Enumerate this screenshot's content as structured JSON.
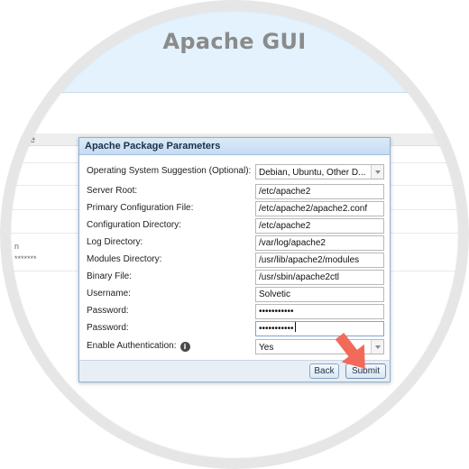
{
  "app": {
    "title": "Apache GUI"
  },
  "background": {
    "column_header_fragment": "alue",
    "row_fragment_1": "n",
    "row_fragment_2": "*******"
  },
  "dialog": {
    "title": "Apache Package Parameters",
    "fields": [
      {
        "label": "Operating System Suggestion (Optional):",
        "type": "select",
        "value": "Debian, Ubuntu, Other D..."
      },
      {
        "label": "Server Root:",
        "type": "text",
        "value": "/etc/apache2"
      },
      {
        "label": "Primary Configuration File:",
        "type": "text",
        "value": "/etc/apache2/apache2.conf"
      },
      {
        "label": "Configuration Directory:",
        "type": "text",
        "value": "/etc/apache2"
      },
      {
        "label": "Log Directory:",
        "type": "text",
        "value": "/var/log/apache2"
      },
      {
        "label": "Modules Directory:",
        "type": "text",
        "value": "/usr/lib/apache2/modules"
      },
      {
        "label": "Binary File:",
        "type": "text",
        "value": "/usr/sbin/apache2ctl"
      },
      {
        "label": "Username:",
        "type": "text",
        "value": "Solvetic"
      },
      {
        "label": "Password:",
        "type": "password",
        "value": "•••••••••••"
      },
      {
        "label": "Password:",
        "type": "password",
        "value": "•••••••••••"
      },
      {
        "label": "Enable Authentication:",
        "type": "select",
        "value": "Yes"
      }
    ],
    "buttons": {
      "back": "Back",
      "submit": "Submit"
    }
  },
  "icons": {
    "info": "info-icon",
    "pointer": "red-arrow-icon"
  },
  "colors": {
    "header_bg": "#e3f2fc",
    "title_text": "#8b8b8b",
    "dialog_border": "#8fb3d6",
    "arrow": "#f26a5a"
  }
}
